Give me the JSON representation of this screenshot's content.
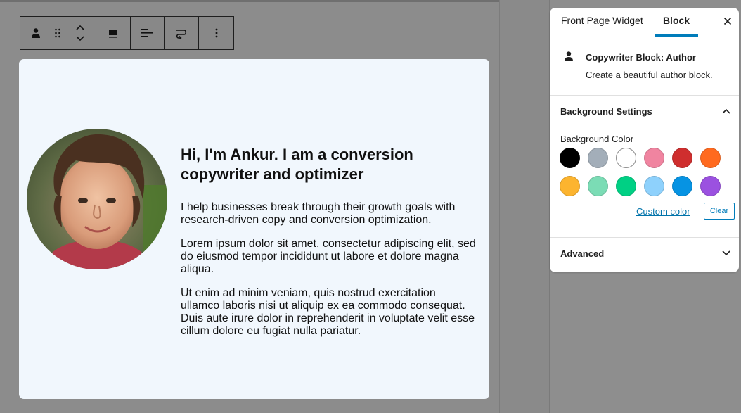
{
  "toolbar": {
    "icons": [
      "author-icon",
      "drag-handle-icon",
      "move-up-down-icon",
      "align-icon",
      "text-align-icon",
      "transform-icon",
      "more-options-icon"
    ]
  },
  "card": {
    "heading": "Hi, I'm Ankur. I am a conversion copywriter and optimizer",
    "paragraphs": [
      "I help businesses break through their growth goals with research-driven copy and conversion optimization.",
      "Lorem ipsum dolor sit amet, consectetur adipiscing elit, sed do eiusmod tempor incididunt ut labore et dolore magna aliqua.",
      "Ut enim ad minim veniam, quis nostrud exercitation ullamco laboris nisi ut aliquip ex ea commodo consequat. Duis aute irure dolor in reprehenderit in voluptate velit esse cillum dolore eu fugiat nulla pariatur."
    ],
    "background_color": "#f1f7fd"
  },
  "sidebar": {
    "tabs": [
      {
        "label": "Front Page Widget",
        "active": false
      },
      {
        "label": "Block",
        "active": true
      }
    ],
    "block": {
      "title": "Copywriter Block: Author",
      "description": "Create a beautiful author block."
    },
    "background_settings": {
      "title": "Background Settings",
      "color_label": "Background Color",
      "colors": [
        "#000000",
        "#a3aeb9",
        "#ffffff",
        "#f084a0",
        "#cf2e2e",
        "#ff6a1f",
        "#fcb42f",
        "#7bdcb5",
        "#00d084",
        "#8ed1fc",
        "#0693e3",
        "#9b51e0"
      ],
      "custom_color_label": "Custom color",
      "clear_label": "Clear"
    },
    "advanced": {
      "title": "Advanced"
    }
  },
  "colors": {
    "accent": "#007cba",
    "link": "#0073aa"
  }
}
